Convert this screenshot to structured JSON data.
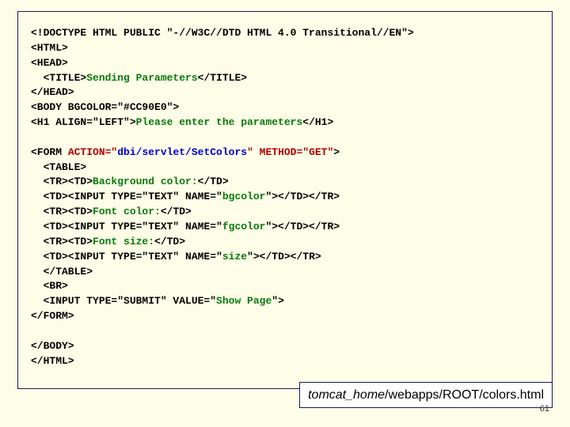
{
  "code": {
    "l1a": "<!DOCTYPE HTML PUBLIC \"-//W3C//DTD HTML 4.0 Transitional//EN\">",
    "l2": "<HTML>",
    "l3": "<HEAD>",
    "l4a": "  <TITLE>",
    "l4b": "Sending Parameters",
    "l4c": "</TITLE>",
    "l5": "</HEAD>",
    "l6": "<BODY BGCOLOR=\"#CC90E0\">",
    "l7a": "<H1 ALIGN=\"LEFT\">",
    "l7b": "Please enter the parameters",
    "l7c": "</H1>",
    "l9a": "<FORM ",
    "l9b": "ACTION=\"",
    "l9c": "dbi/servlet/SetColors",
    "l9d": "\" METHOD=\"GET\"",
    "l9e": ">",
    "l10": "  <TABLE>",
    "l11a": "  <TR><TD>",
    "l11b": "Background color:",
    "l11c": "</TD>",
    "l12a": "  <TD><INPUT TYPE=\"TEXT\" NAME=\"",
    "l12b": "bgcolor",
    "l12c": "\"></TD></TR>",
    "l13a": "  <TR><TD>",
    "l13b": "Font color:",
    "l13c": "</TD>",
    "l14a": "  <TD><INPUT TYPE=\"TEXT\" NAME=\"",
    "l14b": "fgcolor",
    "l14c": "\"></TD></TR>",
    "l15a": "  <TR><TD>",
    "l15b": "Font size:",
    "l15c": "</TD>",
    "l16a": "  <TD><INPUT TYPE=\"TEXT\" NAME=\"",
    "l16b": "size",
    "l16c": "\"></TD></TR>",
    "l17": "  </TABLE>",
    "l18": "  <BR>",
    "l19a": "  <INPUT TYPE=\"SUBMIT\" VALUE=\"",
    "l19b": "Show Page",
    "l19c": "\">",
    "l20": "</FORM>",
    "l22": "</BODY>",
    "l23": "</HTML>"
  },
  "footer": {
    "italic_part": "tomcat_home",
    "rest": "/webapps/ROOT/colors.html"
  },
  "page_number": "61"
}
